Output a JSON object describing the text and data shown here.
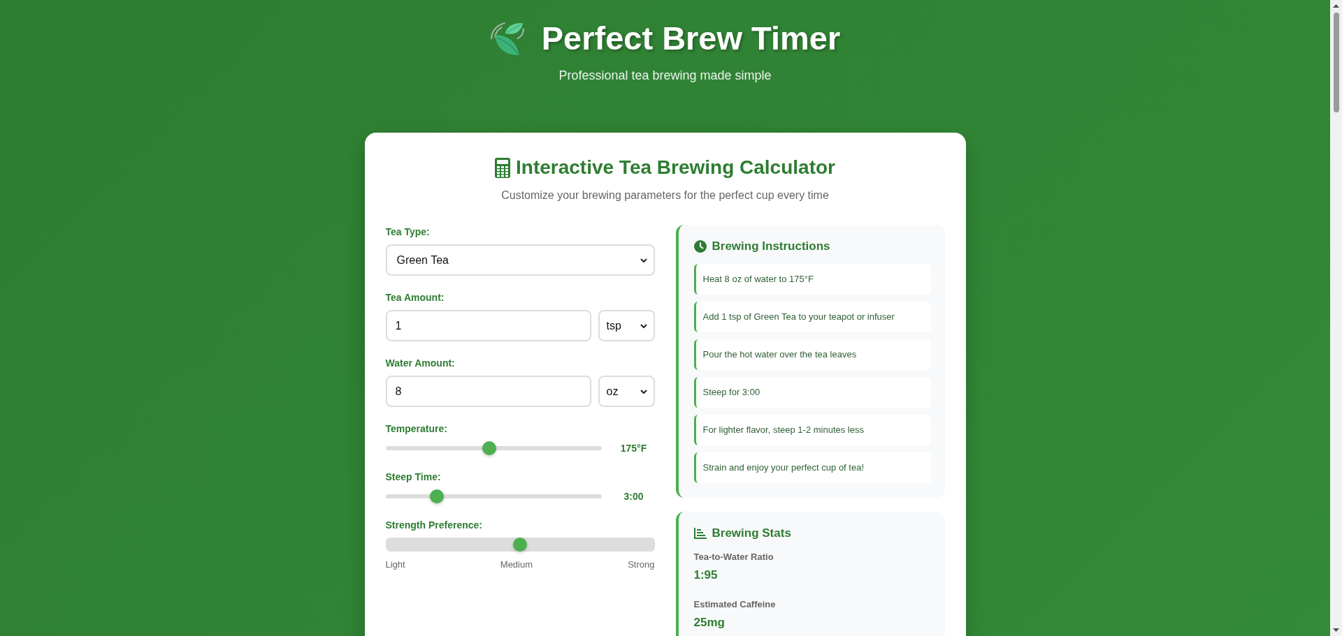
{
  "header": {
    "title": "Perfect Brew Timer",
    "subtitle": "Professional tea brewing made simple"
  },
  "calculator": {
    "title": "Interactive Tea Brewing Calculator",
    "subtitle": "Customize your brewing parameters for the perfect cup every time"
  },
  "form": {
    "fields": [
      {
        "kind": "select",
        "label": "Tea Type:",
        "value": "Green Tea"
      },
      {
        "kind": "amount",
        "label": "Tea Amount:",
        "value": "1",
        "unit": "tsp"
      },
      {
        "kind": "amount",
        "label": "Water Amount:",
        "value": "8",
        "unit": "oz"
      },
      {
        "kind": "slider",
        "label": "Temperature:",
        "level": 0.48,
        "reading": "175°F"
      },
      {
        "kind": "slider",
        "label": "Steep Time:",
        "level": 0.22,
        "reading": "3:00"
      },
      {
        "kind": "scale",
        "label": "Strength Preference:",
        "level": 0.5,
        "scale_labels": [
          "Light",
          "Medium",
          "Strong"
        ]
      }
    ]
  },
  "instructions": {
    "title": "Brewing Instructions",
    "steps": [
      "Heat 8 oz of water to 175°F",
      "Add 1 tsp of Green Tea to your teapot or infuser",
      "Pour the hot water over the tea leaves",
      "Steep for 3:00",
      "For lighter flavor, steep 1-2 minutes less",
      "Strain and enjoy your perfect cup of tea!"
    ]
  },
  "stats": {
    "title": "Brewing Stats",
    "items": [
      {
        "label": "Tea-to-Water Ratio",
        "value": "1:95"
      },
      {
        "label": "Estimated Caffeine",
        "value": "25mg"
      }
    ]
  }
}
